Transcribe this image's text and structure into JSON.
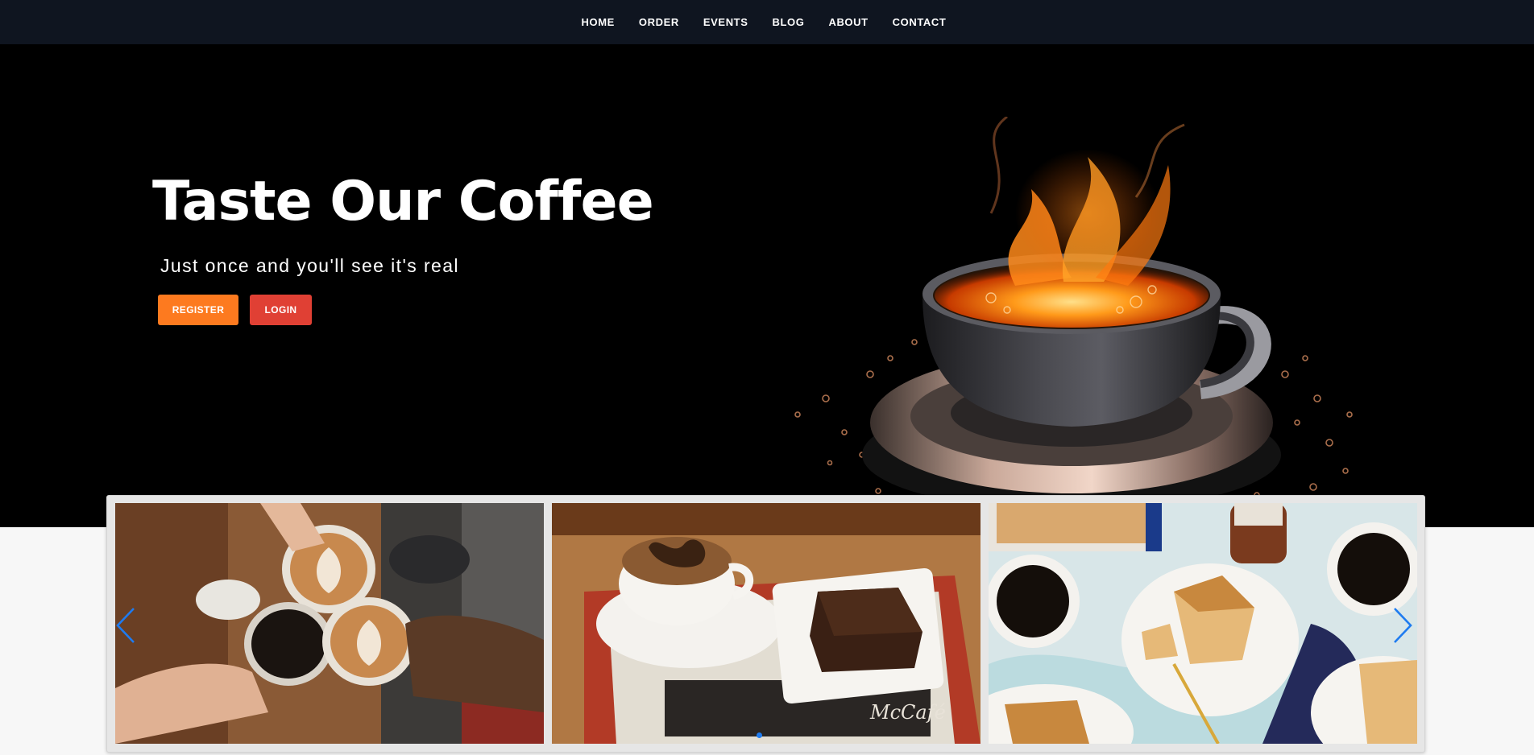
{
  "nav": {
    "items": [
      {
        "label": "HOME"
      },
      {
        "label": "ORDER"
      },
      {
        "label": "EVENTS"
      },
      {
        "label": "BLOG"
      },
      {
        "label": "ABOUT"
      },
      {
        "label": "CONTACT"
      }
    ]
  },
  "hero": {
    "title": "Taste Our Coffee",
    "subtitle": "Just once and you'll see it's real",
    "register_label": "REGISTER",
    "login_label": "LOGIN",
    "image": "flaming-coffee-cup-illustration"
  },
  "carousel": {
    "slides": [
      {
        "image": "latte-cheers-photo"
      },
      {
        "image": "cappuccino-and-cake-tray-photo"
      },
      {
        "image": "coffee-and-crumb-cake-photo"
      }
    ],
    "prev_icon": "chevron-left-icon",
    "next_icon": "chevron-right-icon",
    "dot_count": 1,
    "active_dot": 0
  },
  "colors": {
    "navbar_bg": "#0f1520",
    "hero_bg": "#000000",
    "register": "#fd7a1f",
    "login": "#e04034",
    "accent": "#1e7bf0",
    "page_bg": "#f7f7f7"
  }
}
